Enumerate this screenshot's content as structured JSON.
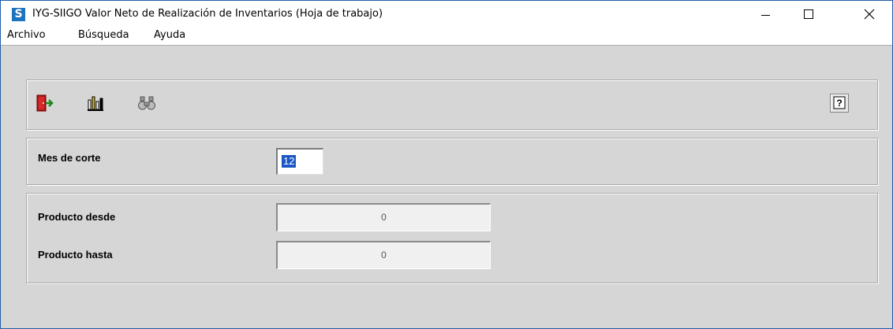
{
  "window": {
    "title": "IYG-SIIGO Valor Neto de Realización de Inventarios (Hoja de trabajo)",
    "icon_letter": "S",
    "accent": "#1e73be"
  },
  "menu": {
    "items": [
      {
        "label": "Archivo"
      },
      {
        "label": "Búsqueda"
      },
      {
        "label": "Ayuda"
      }
    ]
  },
  "toolbar": {
    "exit_icon": "exit-door-icon",
    "report_icon": "bar-chart-icon",
    "search_icon": "binoculars-icon",
    "help_label": "?"
  },
  "form": {
    "mes_de_corte": {
      "label": "Mes de corte",
      "value": "12"
    },
    "producto_desde": {
      "label": "Producto desde",
      "value": "0"
    },
    "producto_hasta": {
      "label": "Producto hasta",
      "value": "0"
    }
  }
}
